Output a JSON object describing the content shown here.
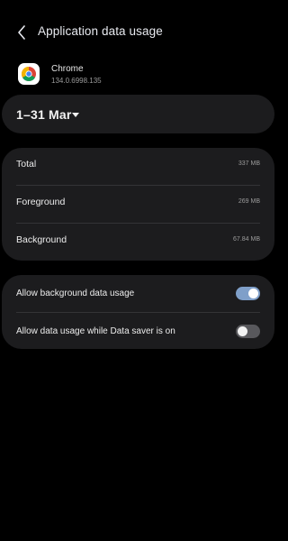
{
  "header": {
    "title": "Application data usage"
  },
  "app": {
    "name": "Chrome",
    "version": "134.0.6998.135",
    "icon": "chrome-icon"
  },
  "date_range": {
    "label": "1–31 Mar"
  },
  "usage": {
    "rows": [
      {
        "label": "Total",
        "value": "337 MB"
      },
      {
        "label": "Foreground",
        "value": "269 MB"
      },
      {
        "label": "Background",
        "value": "67.84 MB"
      }
    ]
  },
  "settings": {
    "toggles": [
      {
        "label": "Allow background data usage",
        "state": "on"
      },
      {
        "label": "Allow data usage while Data saver is on",
        "state": "off"
      }
    ]
  },
  "colors": {
    "background": "#000000",
    "card": "#1c1c1e",
    "toggle_on": "#7f9fc9",
    "toggle_off": "#58585c"
  }
}
